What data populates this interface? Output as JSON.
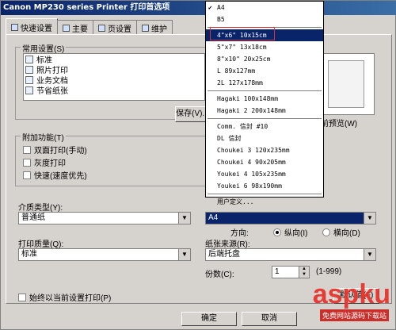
{
  "window": {
    "title": "Canon MP230 series Printer 打印首选项"
  },
  "tabs": [
    {
      "label": "快速设置",
      "active": true
    },
    {
      "label": "主要"
    },
    {
      "label": "页设置"
    },
    {
      "label": "维护"
    }
  ],
  "common_settings": {
    "group_label": "常用设置(S)",
    "items": [
      "标准",
      "照片打印",
      "业务文档",
      "节省纸张"
    ],
    "save_button": "保存(V)..."
  },
  "preview": {
    "label": "前预览(W)"
  },
  "additional": {
    "group_label": "附加功能(T)",
    "options": [
      "双面打印(手动)",
      "灰度打印",
      "快速(速度优先)"
    ]
  },
  "media": {
    "label": "介质类型(Y):",
    "value": "普通纸"
  },
  "paper_size": {
    "value": "A4"
  },
  "orientation": {
    "label": "方向:",
    "portrait": "纵向(I)",
    "landscape": "横向(D)"
  },
  "quality": {
    "label": "打印质量(Q):",
    "value": "标准"
  },
  "paper_source": {
    "label": "纸张来源(R):",
    "value": "后端托盘"
  },
  "copies": {
    "label": "份数(C):",
    "value": "1",
    "range": "(1-999)"
  },
  "always_print": {
    "label": "始终以当前设置打印(P)"
  },
  "defaults_button": "默认值(F)",
  "bottom_buttons": {
    "ok": "确定",
    "cancel": "取消"
  },
  "dropdown": {
    "items": [
      {
        "label": "A4",
        "checked": true
      },
      {
        "label": "B5"
      },
      {
        "label": "4\"x6\" 10x15cm",
        "highlight": true
      },
      {
        "label": "5\"x7\" 13x18cm"
      },
      {
        "label": "8\"x10\" 20x25cm"
      },
      {
        "label": "L 89x127mm"
      },
      {
        "label": "2L 127x178mm"
      },
      {
        "label": "Hagaki 100x148mm"
      },
      {
        "label": "Hagaki 2 200x148mm"
      },
      {
        "label": "Comm. 信封 #10"
      },
      {
        "label": "DL 信封"
      },
      {
        "label": "Choukei 3 120x235mm"
      },
      {
        "label": "Choukei 4 90x205mm"
      },
      {
        "label": "Youkei 4 105x235mm"
      },
      {
        "label": "Youkei 6 98x190mm"
      },
      {
        "label": "用户定义..."
      }
    ]
  },
  "watermark": {
    "text": "aspku",
    "sub": "免费网站源码下载站"
  }
}
